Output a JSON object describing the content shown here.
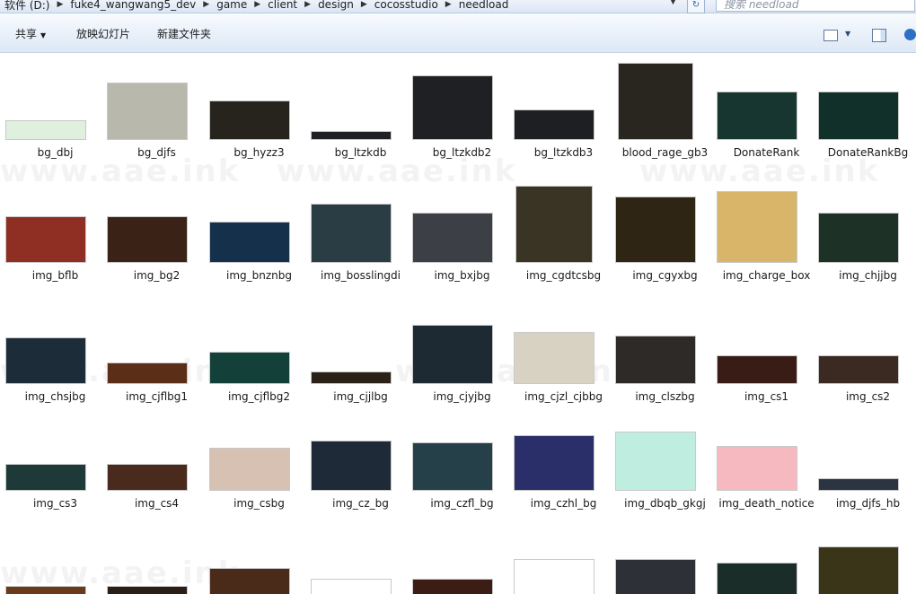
{
  "address": {
    "crumbs": [
      "软件 (D:)",
      "fuke4_wangwang5_dev",
      "game",
      "client",
      "design",
      "cocosstudio",
      "needload"
    ],
    "search_placeholder": "搜索 needload"
  },
  "toolbar": {
    "share": "共享",
    "slideshow": "放映幻灯片",
    "new_folder": "新建文件夹"
  },
  "icons": {
    "crumb_separator": "chevron-right-icon",
    "refresh": "refresh-icon",
    "views": "views-icon",
    "preview_pane": "preview-pane-icon",
    "help": "help-icon"
  },
  "watermark": "www.aae.ink",
  "files": [
    {
      "name": "bg_dbj",
      "color": "#dff0df"
    },
    {
      "name": "bg_djfs",
      "color": "#b9b8ad"
    },
    {
      "name": "bg_hyzz3",
      "color": "#26241d"
    },
    {
      "name": "bg_ltzkdb",
      "color": "#202124"
    },
    {
      "name": "bg_ltzkdb2",
      "color": "#1f2023"
    },
    {
      "name": "bg_ltzkdb3",
      "color": "#1e1f22"
    },
    {
      "name": "blood_rage_gb3",
      "color": "#28261e"
    },
    {
      "name": "DonateRank",
      "color": "#16362f"
    },
    {
      "name": "DonateRankBg",
      "color": "#12302a"
    },
    {
      "name": "img_bflb",
      "color": "#8f2f24"
    },
    {
      "name": "img_bg2",
      "color": "#3a2316"
    },
    {
      "name": "img_bnznbg",
      "color": "#15304b"
    },
    {
      "name": "img_bosslingdi",
      "color": "#2b3d44"
    },
    {
      "name": "img_bxjbg",
      "color": "#3d3f47"
    },
    {
      "name": "img_cgdtcsbg",
      "color": "#3a3424"
    },
    {
      "name": "img_cgyxbg",
      "color": "#2f2515"
    },
    {
      "name": "img_charge_box",
      "color": "#d9b56a"
    },
    {
      "name": "img_chjjbg",
      "color": "#1d3126"
    },
    {
      "name": "img_chsjbg",
      "color": "#1c2c38"
    },
    {
      "name": "img_cjflbg1",
      "color": "#5a2e17"
    },
    {
      "name": "img_cjflbg2",
      "color": "#134038"
    },
    {
      "name": "img_cjjlbg",
      "color": "#2a2216"
    },
    {
      "name": "img_cjyjbg",
      "color": "#1e2a33"
    },
    {
      "name": "img_cjzl_cjbbg",
      "color": "#d8d2c2"
    },
    {
      "name": "img_clszbg",
      "color": "#2d2a27"
    },
    {
      "name": "img_cs1",
      "color": "#3a1c16"
    },
    {
      "name": "img_cs2",
      "color": "#3b2a22"
    },
    {
      "name": "img_cs3",
      "color": "#1d3a38"
    },
    {
      "name": "img_cs4",
      "color": "#4a2a1c"
    },
    {
      "name": "img_csbg",
      "color": "#d7c1b2"
    },
    {
      "name": "img_cz_bg",
      "color": "#1f2a38"
    },
    {
      "name": "img_czfl_bg",
      "color": "#26404a"
    },
    {
      "name": "img_czhl_bg",
      "color": "#2a2f6a"
    },
    {
      "name": "img_dbqb_gkgj",
      "color": "#bfeee0"
    },
    {
      "name": "img_death_notice",
      "color": "#f6b9bf"
    },
    {
      "name": "img_djfs_hb",
      "color": "#2b3440"
    },
    {
      "name": "",
      "color": "#6b3a1c"
    },
    {
      "name": "",
      "color": "#2a1e17"
    },
    {
      "name": "",
      "color": "#4a2a18"
    },
    {
      "name": "",
      "color": "#ffffff"
    },
    {
      "name": "",
      "color": "#3b1d16"
    },
    {
      "name": "",
      "color": "#ffffff"
    },
    {
      "name": "",
      "color": "#2d3036"
    },
    {
      "name": "",
      "color": "#1a2d28"
    },
    {
      "name": "",
      "color": "#3a3518"
    }
  ]
}
